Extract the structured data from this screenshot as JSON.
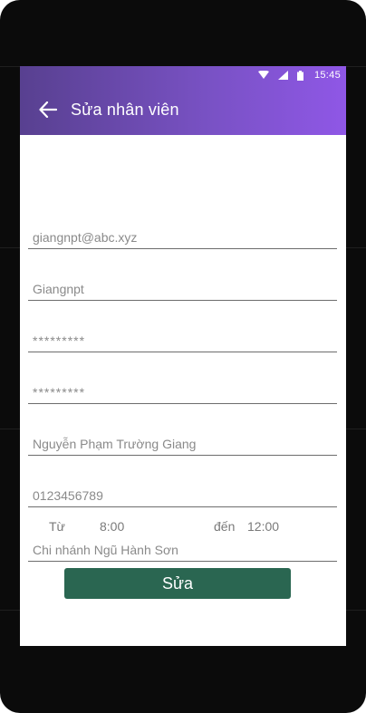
{
  "status_bar": {
    "time": "15:45",
    "icons": [
      "wifi-icon",
      "signal-icon",
      "battery-icon"
    ]
  },
  "toolbar": {
    "back_icon": "arrow-left-icon",
    "title": "Sửa nhân viên",
    "color_start": "#584090",
    "color_end": "#8f57e6"
  },
  "form": {
    "email": {
      "placeholder": "giangnpt@abc.xyz"
    },
    "username": {
      "placeholder": "Giangnpt"
    },
    "password": {
      "placeholder": "*********"
    },
    "confirm_password": {
      "placeholder": "*********"
    },
    "full_name": {
      "placeholder": "Nguyễn Phạm Trường Giang"
    },
    "phone": {
      "placeholder": "0123456789"
    },
    "branch": {
      "placeholder": "Chi nhánh Ngũ Hành Sơn"
    }
  },
  "shift": {
    "from_label": "Từ",
    "from_time": "8:00",
    "to_label": "đến",
    "to_time": "12:00"
  },
  "submit_button": {
    "label": "Sửa",
    "color": "#2a6651"
  }
}
